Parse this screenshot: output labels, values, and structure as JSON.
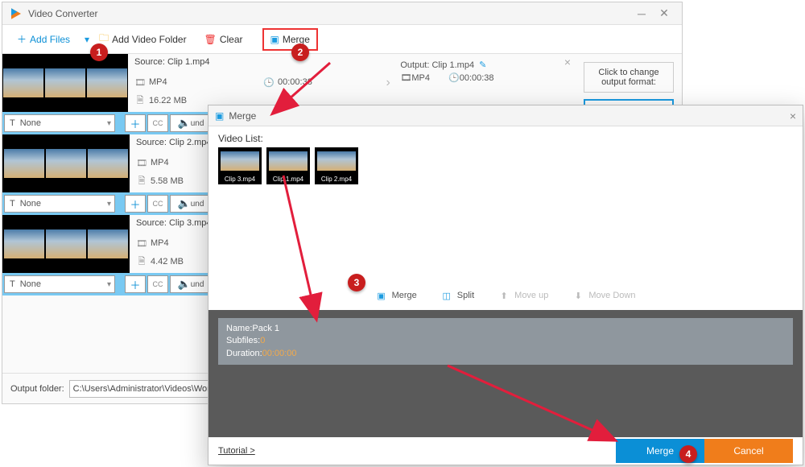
{
  "app": {
    "title": "Video Converter"
  },
  "toolbar": {
    "addFiles": "Add Files",
    "addFolder": "Add Video Folder",
    "clear": "Clear",
    "merge": "Merge"
  },
  "items": [
    {
      "source": "Source: Clip 1.mp4",
      "format": "MP4",
      "duration": "00:00:38",
      "size": "16.22 MB",
      "outName": "Output: Clip 1.mp4",
      "outFormat": "MP4",
      "outDuration": "00:00:38",
      "subtitle": "None",
      "undo": "und"
    },
    {
      "source": "Source: Clip 2.mp4",
      "format": "MP4",
      "duration": "",
      "size": "5.58 MB",
      "outName": "",
      "outFormat": "",
      "outDuration": "",
      "subtitle": "None",
      "undo": "und"
    },
    {
      "source": "Source: Clip 3.mp4",
      "format": "MP4",
      "duration": "",
      "size": "4.42 MB",
      "outName": "",
      "outFormat": "",
      "outDuration": "",
      "subtitle": "None",
      "undo": "und"
    }
  ],
  "right": {
    "changeFormat": "Click to change output format:"
  },
  "footer": {
    "label": "Output folder:",
    "path": "C:\\Users\\Administrator\\Videos\\WonderFo"
  },
  "modal": {
    "title": "Merge",
    "videoList": "Video List:",
    "clips": [
      "Clip 3.mp4",
      "Clip 1.mp4",
      "Clip 2.mp4"
    ],
    "ops": {
      "merge": "Merge",
      "split": "Split",
      "moveUp": "Move up",
      "moveDown": "Move Down"
    },
    "pack": {
      "nameLabel": "Name:",
      "name": "Pack 1",
      "subLabel": "Subfiles:",
      "sub": "0",
      "durLabel": "Duration:",
      "dur": "00:00:00"
    },
    "tutorial": "Tutorial >",
    "mergeBtn": "Merge",
    "cancelBtn": "Cancel"
  },
  "badges": {
    "b1": "1",
    "b2": "2",
    "b3": "3",
    "b4": "4"
  }
}
